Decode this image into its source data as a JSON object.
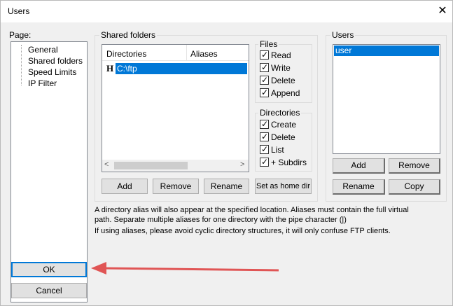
{
  "window": {
    "title": "Users",
    "close_glyph": "✕"
  },
  "page_panel": {
    "label": "Page:",
    "items": [
      "General",
      "Shared folders",
      "Speed Limits",
      "IP Filter"
    ]
  },
  "shared_folders": {
    "label": "Shared folders",
    "columns": [
      "Directories",
      "Aliases"
    ],
    "rows": [
      {
        "flag": "H",
        "directory": "C:\\ftp",
        "alias": ""
      }
    ],
    "scroll_left": "<",
    "scroll_right": ">",
    "buttons": {
      "add": "Add",
      "remove": "Remove",
      "rename": "Rename",
      "home": "Set as home dir"
    }
  },
  "files": {
    "label": "Files",
    "options": [
      {
        "label": "Read",
        "checked": true
      },
      {
        "label": "Write",
        "checked": true
      },
      {
        "label": "Delete",
        "checked": true
      },
      {
        "label": "Append",
        "checked": true
      }
    ]
  },
  "directories": {
    "label": "Directories",
    "options": [
      {
        "label": "Create",
        "checked": true
      },
      {
        "label": "Delete",
        "checked": true
      },
      {
        "label": "List",
        "checked": true
      },
      {
        "label": "+ Subdirs",
        "checked": true
      }
    ]
  },
  "users": {
    "label": "Users",
    "items": [
      "user"
    ],
    "buttons": {
      "add": "Add",
      "remove": "Remove",
      "rename": "Rename",
      "copy": "Copy"
    }
  },
  "info": {
    "line1": "A directory alias will also appear at the specified location. Aliases must contain the full virtual path. Separate multiple aliases for one directory with the pipe character (|)",
    "line2": "If using aliases, please avoid cyclic directory structures, it will only confuse FTP clients."
  },
  "footer": {
    "ok": "OK",
    "cancel": "Cancel"
  },
  "colors": {
    "selection": "#0078d7",
    "annotation_arrow": "#e05555"
  }
}
